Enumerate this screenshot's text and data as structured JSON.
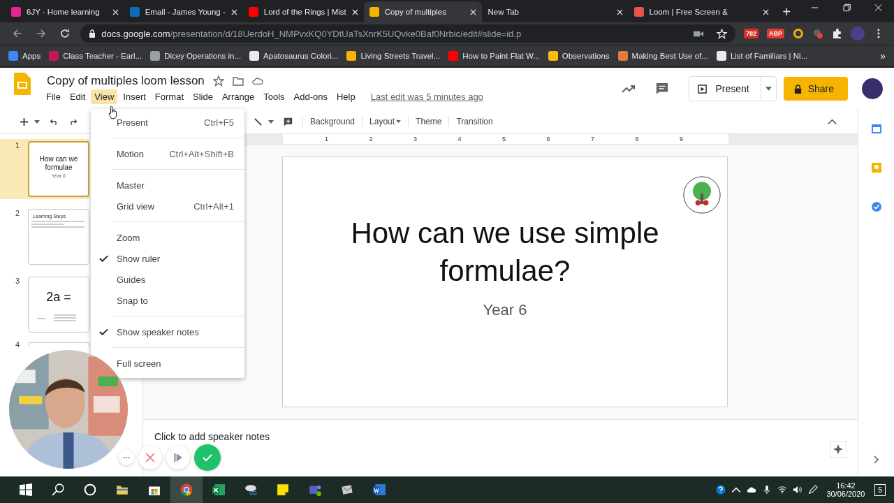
{
  "browser": {
    "tabs": [
      {
        "title": "6JY - Home learning",
        "selected": false,
        "color": "#e52592"
      },
      {
        "title": "Email - James Young -",
        "selected": false,
        "color": "#0f6cbd"
      },
      {
        "title": "Lord of the Rings | Mist",
        "selected": false,
        "color": "#ff0000"
      },
      {
        "title": "Copy of multiples",
        "selected": true,
        "color": "#f4b400"
      },
      {
        "title": "New Tab",
        "selected": false
      },
      {
        "title": "Loom | Free Screen &",
        "selected": false,
        "color": "#e8534a"
      }
    ],
    "new_tab": "+",
    "url_host": "docs.google.com",
    "url_path": "/presentation/d/18UerdoH_NMPvxKQ0YDtUaTsXnrK5UQvke0Baf0Nrbic/edit#slide=id.p",
    "extensions": [
      {
        "label": "782",
        "color": "#d93025"
      },
      {
        "label": "ABP",
        "color": "#e53935"
      }
    ],
    "bookmarks": [
      {
        "label": "Apps",
        "color": "#4285f4"
      },
      {
        "label": "Class Teacher - Earl...",
        "color": "#c2185b"
      },
      {
        "label": "Dicey Operations in...",
        "color": "#9aa0a6"
      },
      {
        "label": "Apatosaurus Colori...",
        "color": "#e8eaed"
      },
      {
        "label": "Living Streets Travel...",
        "color": "#f4b400"
      },
      {
        "label": "How to Paint Flat W...",
        "color": "#ff0000"
      },
      {
        "label": "Observations",
        "color": "#fbbc04"
      },
      {
        "label": "Making Best Use of...",
        "color": "#e67c3b"
      },
      {
        "label": "List of Familiars | Ni...",
        "color": "#e8eaed"
      }
    ],
    "more": "»"
  },
  "doc": {
    "title": "Copy of multiples loom lesson",
    "menus": [
      {
        "label": "File",
        "selected": false
      },
      {
        "label": "Edit",
        "selected": false
      },
      {
        "label": "View",
        "selected": true
      },
      {
        "label": "Insert",
        "selected": false
      },
      {
        "label": "Format",
        "selected": false
      },
      {
        "label": "Slide",
        "selected": false
      },
      {
        "label": "Arrange",
        "selected": false
      },
      {
        "label": "Tools",
        "selected": false
      },
      {
        "label": "Add-ons",
        "selected": false
      },
      {
        "label": "Help",
        "selected": false
      }
    ],
    "last_edit": "Last edit was 5 minutes ago",
    "present": "Present",
    "share": "Share"
  },
  "toolbar": [
    "Background",
    "Layout",
    "Theme",
    "Transition"
  ],
  "ruler": [
    "1",
    "2",
    "3",
    "4",
    "5",
    "6",
    "7",
    "8",
    "9"
  ],
  "slides": [
    {
      "number": "1",
      "selected": true,
      "title": [
        "How can we",
        "formulae"
      ],
      "subtitle": "Year 6"
    },
    {
      "number": "2",
      "selected": false,
      "heading": "Learning Steps"
    },
    {
      "number": "3",
      "selected": false,
      "big": "2a ="
    },
    {
      "number": "4",
      "selected": false
    }
  ],
  "slide": {
    "title": "How can we use simple formulae?",
    "subtitle": "Year 6"
  },
  "notes": "Click to add speaker notes",
  "view_menu": [
    [
      {
        "label": "Present",
        "shortcut": "Ctrl+F5",
        "checked": false
      }
    ],
    [
      {
        "label": "Motion",
        "shortcut": "Ctrl+Alt+Shift+B",
        "checked": false
      }
    ],
    [
      {
        "label": "Master",
        "checked": false
      },
      {
        "label": "Grid view",
        "shortcut": "Ctrl+Alt+1",
        "checked": false
      }
    ],
    [
      {
        "label": "Zoom",
        "checked": false
      },
      {
        "label": "Show ruler",
        "checked": true
      },
      {
        "label": "Guides",
        "checked": false
      },
      {
        "label": "Snap to",
        "checked": false
      }
    ],
    [
      {
        "label": "Show speaker notes",
        "checked": true
      }
    ],
    [
      {
        "label": "Full screen",
        "checked": false
      }
    ]
  ],
  "taskbar": {
    "time": "16:42",
    "date": "30/06/2020",
    "notifications": "5"
  }
}
